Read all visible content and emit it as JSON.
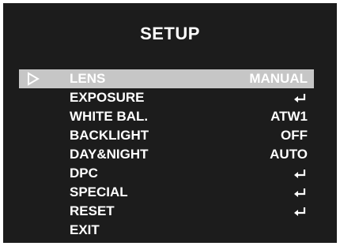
{
  "menu": {
    "title": "SETUP",
    "cursor_icon": "triangle-right-icon",
    "enter_icon": "enter-return-icon",
    "items": [
      {
        "label": "LENS",
        "value": "MANUAL",
        "selected": true
      },
      {
        "label": "EXPOSURE",
        "value": "",
        "icon": "enter-return-icon"
      },
      {
        "label": "WHITE BAL.",
        "value": "ATW1"
      },
      {
        "label": "BACKLIGHT",
        "value": "OFF"
      },
      {
        "label": "DAY&NIGHT",
        "value": "AUTO"
      },
      {
        "label": "DPC",
        "value": "",
        "icon": "enter-return-icon"
      },
      {
        "label": "SPECIAL",
        "value": "",
        "icon": "enter-return-icon"
      },
      {
        "label": "RESET",
        "value": "",
        "icon": "enter-return-icon"
      },
      {
        "label": "EXIT",
        "value": ""
      }
    ]
  },
  "colors": {
    "background": "#1c1c1c",
    "highlight": "#c6c6c6",
    "text": "#ffffff"
  }
}
